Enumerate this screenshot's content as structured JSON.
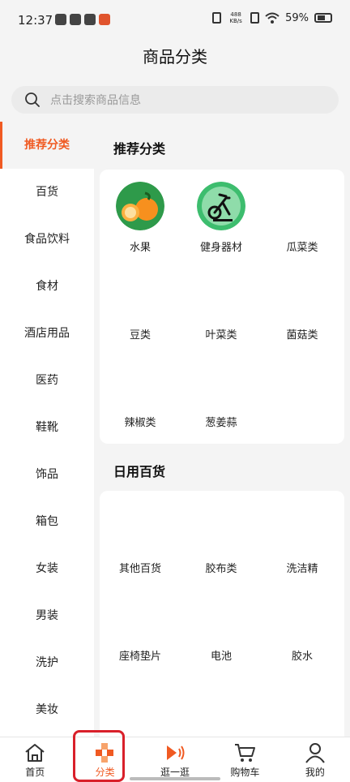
{
  "status_bar": {
    "time": "12:37",
    "net_speed_value": "488",
    "net_speed_unit": "KB/s",
    "battery": "59%"
  },
  "header": {
    "title": "商品分类"
  },
  "search": {
    "placeholder": "点击搜索商品信息"
  },
  "sidebar": {
    "items": [
      {
        "label": "推荐分类",
        "active": true
      },
      {
        "label": "百货"
      },
      {
        "label": "食品饮料"
      },
      {
        "label": "食材"
      },
      {
        "label": "酒店用品"
      },
      {
        "label": "医药"
      },
      {
        "label": "鞋靴"
      },
      {
        "label": "饰品"
      },
      {
        "label": "箱包"
      },
      {
        "label": "女装"
      },
      {
        "label": "男装"
      },
      {
        "label": "洗护"
      },
      {
        "label": "美妆"
      }
    ]
  },
  "sections": [
    {
      "title": "推荐分类",
      "items": [
        {
          "label": "水果",
          "icon": "orange-fruit-icon"
        },
        {
          "label": "健身器材",
          "icon": "exercise-bike-icon"
        },
        {
          "label": "瓜菜类"
        },
        {
          "label": "豆类"
        },
        {
          "label": "叶菜类"
        },
        {
          "label": "菌菇类"
        },
        {
          "label": "辣椒类"
        },
        {
          "label": "葱姜蒜"
        }
      ]
    },
    {
      "title": "日用百货",
      "items": [
        {
          "label": "其他百货"
        },
        {
          "label": "胶布类"
        },
        {
          "label": "洗洁精"
        },
        {
          "label": "座椅垫片"
        },
        {
          "label": "电池"
        },
        {
          "label": "胶水"
        }
      ]
    }
  ],
  "tabbar": {
    "items": [
      {
        "label": "首页",
        "icon": "home-icon"
      },
      {
        "label": "分类",
        "icon": "category-icon",
        "active": true
      },
      {
        "label": "逛一逛",
        "icon": "play-sound-icon"
      },
      {
        "label": "购物车",
        "icon": "cart-icon"
      },
      {
        "label": "我的",
        "icon": "profile-icon"
      }
    ]
  },
  "colors": {
    "accent": "#f05a22",
    "highlight_box": "#d9202a"
  }
}
